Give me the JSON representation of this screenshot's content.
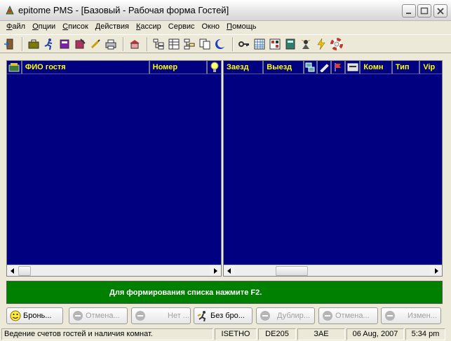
{
  "window": {
    "title": "epitome PMS - [Базовый - Рабочая форма Гостей]"
  },
  "menu": [
    {
      "underline": "Ф",
      "rest": "айл"
    },
    {
      "underline": "О",
      "rest": "пции"
    },
    {
      "underline": "С",
      "rest": "писок"
    },
    {
      "underline": "Д",
      "rest": "ействия"
    },
    {
      "underline": "К",
      "rest": "ассир"
    },
    {
      "underline": "",
      "rest": "Сервис"
    },
    {
      "underline": "",
      "rest": "Окно"
    },
    {
      "underline": "П",
      "rest": "омощь"
    }
  ],
  "left_grid": {
    "columns": {
      "name": "ФИО гостя",
      "number": "Номер"
    }
  },
  "right_grid": {
    "columns": {
      "arrival": "Заезд",
      "departure": "Выезд",
      "comm": "Комн",
      "type": "Тип",
      "vip": "Vip"
    }
  },
  "message": "Для формирования списка нажмите F2.",
  "actions": {
    "booking": "Бронь...",
    "cancel": "Отмена...",
    "no": "Нет ...",
    "without_booking": "Без бро...",
    "duplicate": "Дублир...",
    "cancel2": "Отмена...",
    "change": "Измен..."
  },
  "status": {
    "hint": "Ведение счетов гостей и наличия комнат.",
    "user": "ISETHO",
    "station": "DE205",
    "currency": "ЗАЕ",
    "date": "06 Aug, 2007",
    "time": "5:34 pm"
  },
  "colors": {
    "grid_bg": "#000080",
    "header_text": "#ffff00",
    "message_bg": "#008000"
  }
}
